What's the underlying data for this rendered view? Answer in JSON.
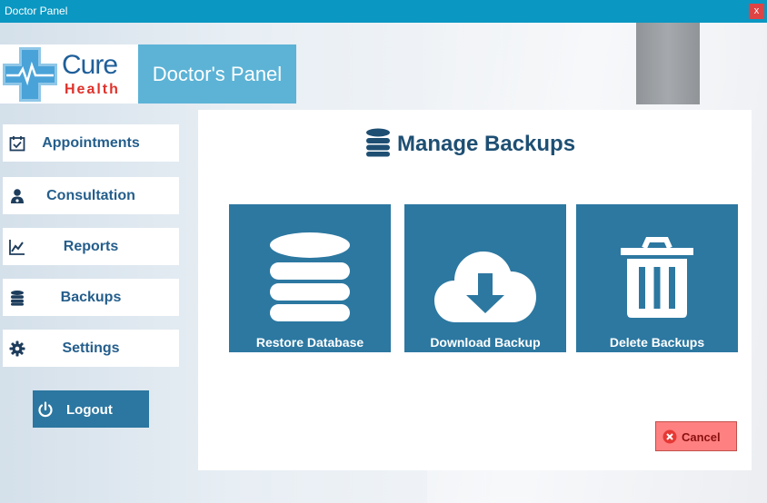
{
  "window": {
    "title": "Doctor Panel",
    "close_label": "x"
  },
  "brand": {
    "cure": "Cure",
    "health": "Health",
    "panel_title": "Doctor's Panel"
  },
  "sidebar": {
    "items": [
      {
        "label": "Appointments",
        "icon": "calendar-check-icon"
      },
      {
        "label": "Consultation",
        "icon": "doctor-icon"
      },
      {
        "label": "Reports",
        "icon": "line-chart-icon"
      },
      {
        "label": "Backups",
        "icon": "database-icon"
      },
      {
        "label": "Settings",
        "icon": "gear-icon"
      }
    ],
    "logout_label": "Logout"
  },
  "main": {
    "title": "Manage Backups",
    "tiles": [
      {
        "label": "Restore Database",
        "icon": "database-icon"
      },
      {
        "label": "Download Backup",
        "icon": "cloud-download-icon"
      },
      {
        "label": "Delete Backups",
        "icon": "trash-icon"
      }
    ],
    "cancel_label": "Cancel"
  },
  "colors": {
    "titlebar": "#0a97c2",
    "accent": "#2c78a1",
    "panel_title": "#5cb3d6",
    "nav_text": "#245e8c",
    "cancel": "#ff8080"
  }
}
